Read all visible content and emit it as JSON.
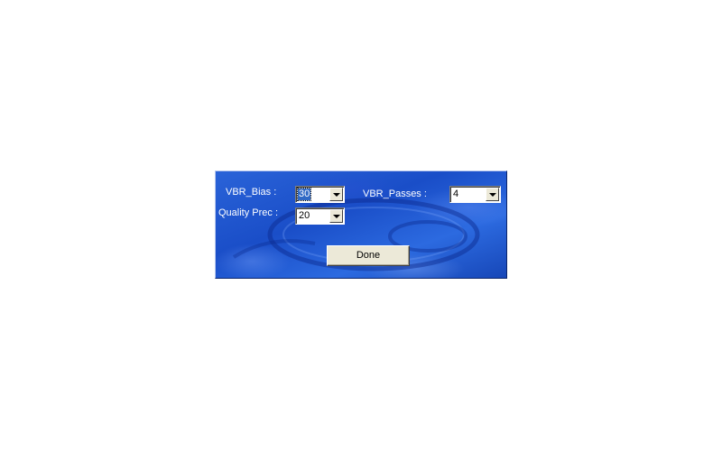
{
  "dialog": {
    "vbr_bias": {
      "label": "VBR_Bias :",
      "value": "30"
    },
    "vbr_passes": {
      "label": "VBR_Passes :",
      "value": "4"
    },
    "quality_prec": {
      "label": "Quality Prec :",
      "value": "20"
    },
    "done_label": "Done"
  },
  "colors": {
    "dialog_background": "#2a63d8",
    "button_face": "#ece9d8",
    "selection": "#316ac5"
  },
  "icons": {
    "dropdown": "chevron-down-icon"
  }
}
